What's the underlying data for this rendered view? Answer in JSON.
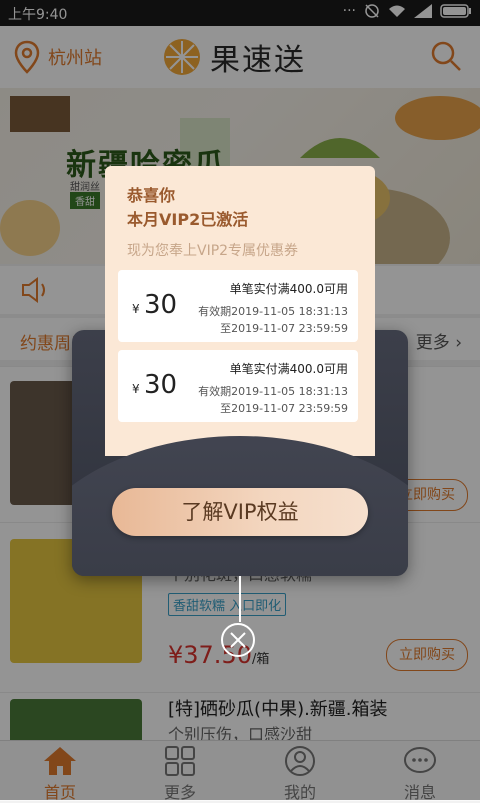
{
  "status": {
    "time": "上午9:40"
  },
  "header": {
    "location": "杭州站",
    "brand": "果速送"
  },
  "banner": {
    "title": "新疆哈密瓜",
    "subtitle": "甜润丝",
    "tag": "香甜"
  },
  "section": {
    "title": "约惠周五-",
    "more": "更多"
  },
  "products": [
    {
      "title": "",
      "desc": "",
      "chip": "",
      "price": "",
      "unit": "",
      "buy": "立即购买"
    },
    {
      "title": "",
      "desc": "个别花斑，口感软糯",
      "chip": "香甜软糯 入口即化",
      "price": "¥37.50",
      "unit": "/箱",
      "buy": "立即购买"
    },
    {
      "title": "[特]硒砂瓜(中果).新疆.箱装",
      "desc": "个别压伤，口感沙甜",
      "chip": "",
      "price": "",
      "unit": "",
      "buy": ""
    }
  ],
  "popup": {
    "congrats": "恭喜你",
    "activated": "本月VIP2已激活",
    "offer": "现为您奉上VIP2专属优惠券",
    "coupons": [
      {
        "currency": "¥",
        "amount": "30",
        "condition": "单笔实付满400.0可用",
        "valid_from": "有效期2019-11-05 18:31:13",
        "valid_to": "至2019-11-07 23:59:59"
      },
      {
        "currency": "¥",
        "amount": "30",
        "condition": "单笔实付满400.0可用",
        "valid_from": "有效期2019-11-05 18:31:13",
        "valid_to": "至2019-11-07 23:59:59"
      }
    ],
    "button": "了解VIP权益"
  },
  "tabs": [
    {
      "label": "首页",
      "icon": "home-icon"
    },
    {
      "label": "更多",
      "icon": "grid-icon"
    },
    {
      "label": "我的",
      "icon": "user-icon"
    },
    {
      "label": "消息",
      "icon": "chat-icon"
    }
  ],
  "colors": {
    "accent": "#e07a2e",
    "price": "#d9322d",
    "gold": "#e8b896"
  }
}
